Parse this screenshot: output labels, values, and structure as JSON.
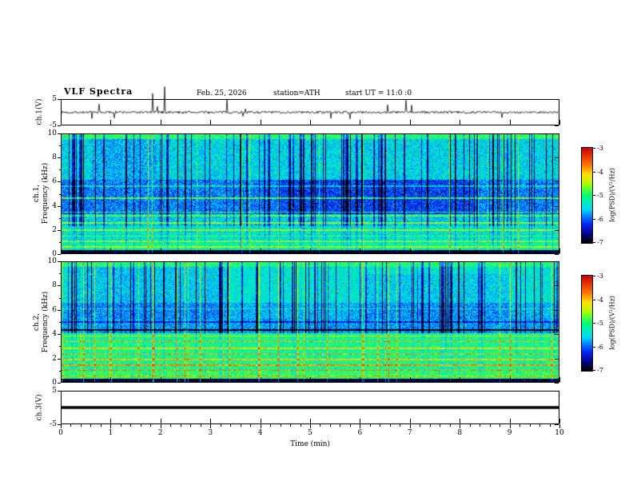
{
  "header": {
    "title": "VLF Spectra",
    "date": "Feb. 25, 2026",
    "station": "station=ATH",
    "start_ut": "start UT =  11:0 :0"
  },
  "x_axis": {
    "label": "Time (min)",
    "major_ticks": [
      0,
      1,
      2,
      3,
      4,
      5,
      6,
      7,
      8,
      9,
      10
    ],
    "minor_step": 0.2,
    "range": [
      0,
      10
    ]
  },
  "panels": {
    "wave1": {
      "ylabel": "ch.1(V)",
      "yticks": [
        5,
        -5
      ],
      "yrange": [
        -5,
        5
      ]
    },
    "spec1": {
      "ylabel_ch": "ch.1,",
      "ylabel_axis": "Frequency (kHz)",
      "yticks": [
        0,
        2,
        4,
        6,
        8,
        10
      ],
      "yrange": [
        0,
        10
      ]
    },
    "spec2": {
      "ylabel_ch": "ch.2,",
      "ylabel_axis": "Frequency (kHz)",
      "yticks": [
        0,
        2,
        4,
        6,
        8,
        10
      ],
      "yrange": [
        0,
        10
      ]
    },
    "wave3": {
      "ylabel": "ch.3(V)",
      "yticks": [
        5,
        -5
      ],
      "yrange": [
        -5,
        5
      ]
    }
  },
  "colorbars": [
    {
      "label": "log(PSD)/(V²/Hz)",
      "ticks": [
        -3,
        -4,
        -5,
        -6,
        -7
      ],
      "range": [
        -7,
        -3
      ]
    },
    {
      "label": "log(PSD)/(V²/Hz)",
      "ticks": [
        -3,
        -4,
        -5,
        -6,
        -7
      ],
      "range": [
        -7,
        -3
      ]
    }
  ],
  "colormap": {
    "name": "jet-dark-low",
    "stops": [
      [
        0.0,
        "#000000"
      ],
      [
        0.08,
        "#000080"
      ],
      [
        0.2,
        "#0028ff"
      ],
      [
        0.35,
        "#00d8ff"
      ],
      [
        0.5,
        "#00ff78"
      ],
      [
        0.62,
        "#a8ff00"
      ],
      [
        0.72,
        "#ffe000"
      ],
      [
        0.83,
        "#ff7000"
      ],
      [
        1.0,
        "#cc0000"
      ]
    ]
  },
  "chart_data": [
    {
      "panel": "wave1",
      "type": "line",
      "title": "ch.1 waveform",
      "xlabel": "Time (min)",
      "ylabel": "ch.1(V)",
      "xlim": [
        0,
        10
      ],
      "ylim": [
        -5,
        5
      ],
      "baseline": 0,
      "noise_amp": 0.5,
      "spike_prob": 0.02,
      "spike_amp": [
        1.5,
        4.2
      ],
      "spikes_at": [
        [
          1.83,
          7.6
        ],
        [
          2.07,
          10.3
        ],
        [
          3.32,
          5.4
        ],
        [
          6.93,
          4.9
        ]
      ],
      "seed": 7,
      "summary": "continuous broadband noise centred on 0 V with impulsive sferic spikes of 2-5 V; a few spikes near t=1.8-2.1 min exceed the +5 V axis"
    },
    {
      "panel": "spec1",
      "type": "heatmap",
      "title": "ch.1 spectrogram",
      "xlabel": "Time (min)",
      "ylabel": "Frequency (kHz)",
      "xlim": [
        0,
        10
      ],
      "ylim": [
        0,
        10
      ],
      "zlabel": "log(PSD)/(V²/Hz)",
      "zlim": [
        -7,
        -3
      ],
      "seed": 101,
      "noise": 0.22,
      "bands": [
        [
          0,
          0.25,
          0.02
        ],
        [
          0.25,
          0.9,
          0.45
        ],
        [
          0.9,
          2.3,
          0.4
        ],
        [
          2.3,
          3.3,
          0.36
        ],
        [
          3.3,
          6.2,
          0.27
        ],
        [
          6.2,
          9.6,
          0.37
        ],
        [
          9.6,
          10,
          0.5
        ]
      ],
      "tones": [
        [
          0.55,
          0.18,
          0.05
        ],
        [
          1.0,
          0.2,
          0.05
        ],
        [
          1.45,
          0.16,
          0.05
        ],
        [
          1.95,
          0.22,
          0.05
        ],
        [
          2.55,
          0.24,
          0.06
        ],
        [
          3.15,
          0.2,
          0.05
        ],
        [
          3.45,
          0.26,
          0.05
        ],
        [
          4.65,
          0.3,
          0.07
        ],
        [
          5.65,
          0.14,
          0.05
        ]
      ],
      "patches": [
        {
          "t": [
            4.4,
            8.3
          ],
          "f": [
            3.3,
            6.2
          ],
          "delta": -0.06
        },
        {
          "t": [
            0.6,
            1.9
          ],
          "f": [
            6.2,
            9.6
          ],
          "delta": -0.05
        }
      ],
      "streak_prob": 0.13,
      "streak_depth": [
        0.18,
        0.42
      ],
      "streak_fmin": 2.3,
      "bright_prob": 0.035,
      "bright_gain": [
        0.1,
        0.28
      ],
      "speckle_prob": 0.003,
      "speckle_level": [
        0.7,
        1.0
      ],
      "summary": "0-10 kHz spectrogram of ch.1: cyan-green background, dense dark-blue vertical sferic streaks (strongest 3-6 kHz), persistent horizontal tone lines near 1, 2, 2.5, 3.4 and 4.6 kHz, solid black band below 0.25 kHz"
    },
    {
      "panel": "spec2",
      "type": "heatmap",
      "title": "ch.2 spectrogram",
      "xlabel": "Time (min)",
      "ylabel": "Frequency (kHz)",
      "xlim": [
        0,
        10
      ],
      "ylim": [
        0,
        10
      ],
      "zlabel": "log(PSD)/(V²/Hz)",
      "zlim": [
        -7,
        -3
      ],
      "seed": 202,
      "noise": 0.2,
      "bands": [
        [
          0,
          0.25,
          0.03
        ],
        [
          0.25,
          1.0,
          0.52
        ],
        [
          1.0,
          4.1,
          0.48
        ],
        [
          4.1,
          5.3,
          0.3
        ],
        [
          5.3,
          6.6,
          0.33
        ],
        [
          6.6,
          9.6,
          0.4
        ],
        [
          9.6,
          10,
          0.5
        ]
      ],
      "tones": [
        [
          0.5,
          0.26,
          0.06
        ],
        [
          0.95,
          0.3,
          0.05
        ],
        [
          1.4,
          0.33,
          0.05
        ],
        [
          1.85,
          0.26,
          0.05
        ],
        [
          2.3,
          0.31,
          0.06
        ],
        [
          2.8,
          0.24,
          0.05
        ],
        [
          3.35,
          0.3,
          0.05
        ],
        [
          3.85,
          0.22,
          0.05
        ],
        [
          4.35,
          -0.38,
          0.05
        ],
        [
          5.0,
          -0.12,
          0.06
        ],
        [
          6.1,
          0.12,
          0.05
        ]
      ],
      "patches": [
        {
          "t": [
            0.2,
            3.3
          ],
          "f": [
            5.3,
            9.6
          ],
          "delta": -0.05
        },
        {
          "t": [
            6.0,
            9.0
          ],
          "f": [
            5.3,
            9.0
          ],
          "delta": -0.04
        }
      ],
      "streak_prob": 0.12,
      "streak_depth": [
        0.15,
        0.4
      ],
      "streak_fmin": 4.1,
      "bright_prob": 0.05,
      "bright_gain": [
        0.1,
        0.3
      ],
      "speckle_prob": 0.004,
      "speckle_level": [
        0.7,
        1.0
      ],
      "summary": "0-10 kHz spectrogram of ch.2: strong green/yellow horizontal banding below 4 kHz with orange tone lines, dark notch near 4.3 kHz, blue streaked region above 5 kHz, solid black band below 0.25 kHz"
    },
    {
      "panel": "wave3",
      "type": "line",
      "title": "ch.3 waveform",
      "xlabel": "Time (min)",
      "ylabel": "ch.3(V)",
      "xlim": [
        0,
        10
      ],
      "ylim": [
        -5,
        5
      ],
      "flat_value": 0,
      "line_width": 3.5,
      "summary": "ch.3 constant 0 V - thick flat black line (no signal)"
    }
  ]
}
